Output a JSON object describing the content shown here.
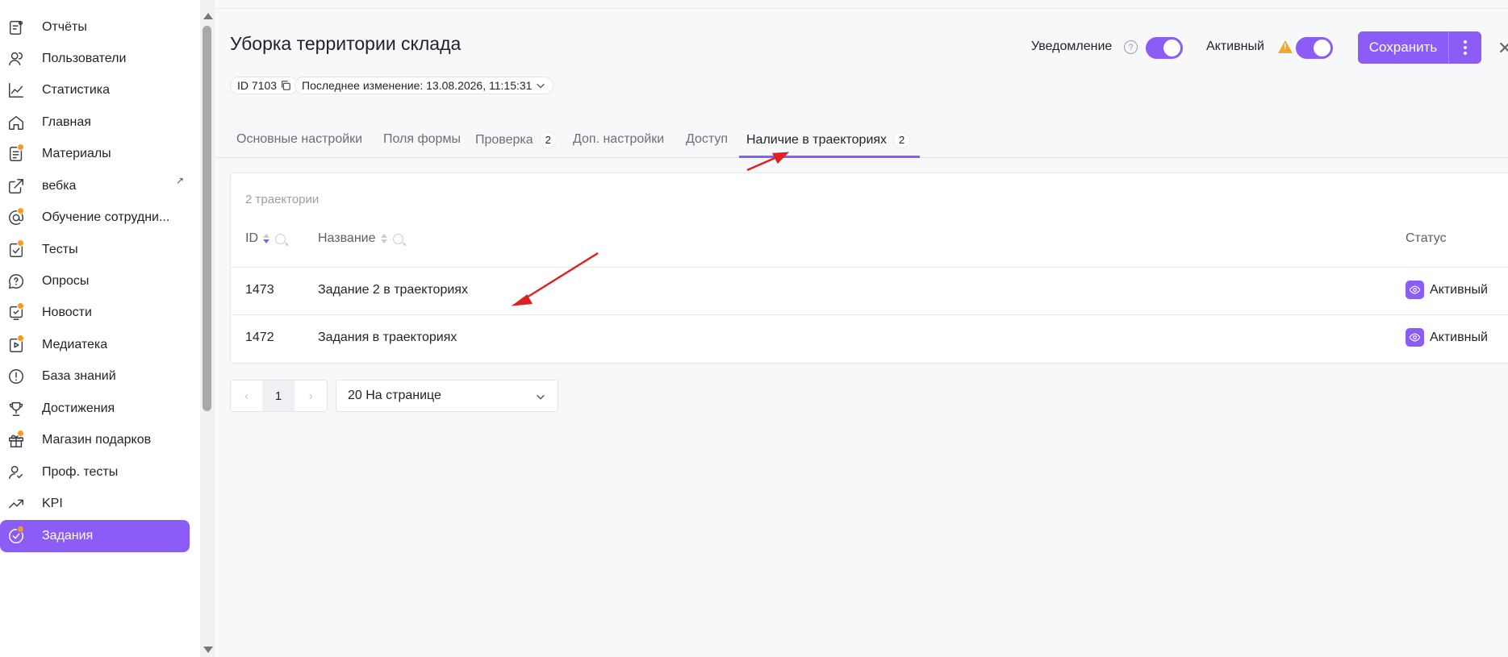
{
  "sidebar": {
    "items": [
      {
        "label": "Отчёты",
        "icon": "report-icon",
        "dot": false
      },
      {
        "label": "Пользователи",
        "icon": "users-icon",
        "dot": false
      },
      {
        "label": "Статистика",
        "icon": "chart-icon",
        "dot": false
      },
      {
        "label": "Главная",
        "icon": "home-icon",
        "dot": false
      },
      {
        "label": "Материалы",
        "icon": "materials-icon",
        "dot": true
      },
      {
        "label": "вебка",
        "icon": "external-link-icon",
        "dot": false,
        "external": "↗"
      },
      {
        "label": "Обучение сотрудни...",
        "icon": "at-icon",
        "dot": true
      },
      {
        "label": "Тесты",
        "icon": "tests-icon",
        "dot": true
      },
      {
        "label": "Опросы",
        "icon": "survey-icon",
        "dot": false
      },
      {
        "label": "Новости",
        "icon": "news-icon",
        "dot": true
      },
      {
        "label": "Медиатека",
        "icon": "media-icon",
        "dot": true
      },
      {
        "label": "База знаний",
        "icon": "knowledge-icon",
        "dot": false
      },
      {
        "label": "Достижения",
        "icon": "trophy-icon",
        "dot": false
      },
      {
        "label": "Магазин подарков",
        "icon": "gift-icon",
        "dot": true
      },
      {
        "label": "Проф. тесты",
        "icon": "prof-test-icon",
        "dot": false
      },
      {
        "label": "KPI",
        "icon": "trend-icon",
        "dot": false
      },
      {
        "label": "Задания",
        "icon": "tasks-icon",
        "dot": true,
        "active": true
      }
    ]
  },
  "header": {
    "title": "Уборка территории склада",
    "id_label": "ID 7103",
    "last_changed": "Последнее изменение: 13.08.2026, 11:15:31",
    "notification_label": "Уведомление",
    "help_glyph": "?",
    "active_label": "Активный",
    "warn_glyph": "!",
    "save_label": "Сохранить",
    "close_glyph": "✕"
  },
  "tabs": [
    {
      "label": "Основные настройки",
      "badge": ""
    },
    {
      "label": "Поля формы",
      "badge": ""
    },
    {
      "label": "Проверка",
      "badge": "2"
    },
    {
      "label": "Доп. настройки",
      "badge": ""
    },
    {
      "label": "Доступ",
      "badge": ""
    },
    {
      "label": "Наличие в траекториях",
      "badge": "2",
      "active": true
    }
  ],
  "table": {
    "count_label": "2 траектории",
    "columns": {
      "id": "ID",
      "name": "Название",
      "status": "Статус"
    },
    "rows": [
      {
        "id": "1473",
        "name": "Задание 2 в траекториях",
        "status": "Активный"
      },
      {
        "id": "1472",
        "name": "Задания в траекториях",
        "status": "Активный"
      }
    ]
  },
  "pagination": {
    "prev": "‹",
    "current": "1",
    "next": "›",
    "page_size": "20 На странице"
  },
  "colors": {
    "accent": "#8b5cf6",
    "badge_dot": "#f59a23",
    "annotation_arrow": "#e02020"
  }
}
